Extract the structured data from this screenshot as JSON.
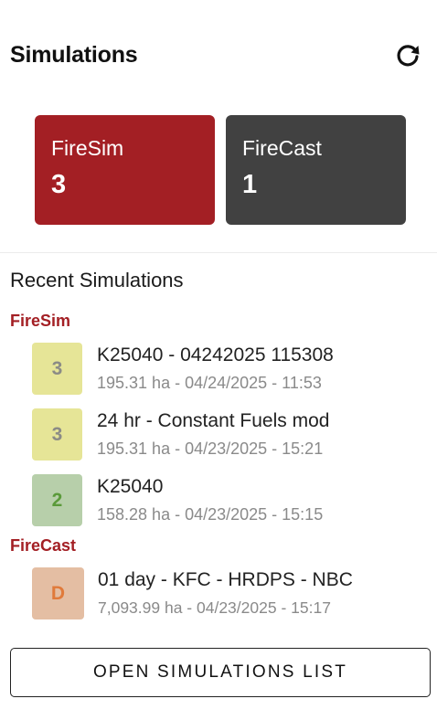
{
  "header": {
    "title": "Simulations",
    "refresh_icon": "refresh-icon"
  },
  "summary_cards": [
    {
      "label": "FireSim",
      "count": "3",
      "color": "#a31f24"
    },
    {
      "label": "FireCast",
      "count": "1",
      "color": "#414141"
    }
  ],
  "recent": {
    "title": "Recent Simulations",
    "groups": [
      {
        "label": "FireSim",
        "color": "#a31f24",
        "items": [
          {
            "badge": "3",
            "badge_bg": "#e6e597",
            "badge_fg": "#8b8b86",
            "title": "K25040 - 04242025 115308",
            "subtitle": "195.31 ha - 04/24/2025 - 11:53"
          },
          {
            "badge": "3",
            "badge_bg": "#e6e597",
            "badge_fg": "#8b8b86",
            "title": "24 hr - Constant Fuels mod",
            "subtitle": "195.31 ha - 04/23/2025 - 15:21"
          },
          {
            "badge": "2",
            "badge_bg": "#b7cfaa",
            "badge_fg": "#5a9a3a",
            "title": "K25040",
            "subtitle": "158.28 ha - 04/23/2025 - 15:15"
          }
        ]
      },
      {
        "label": "FireCast",
        "color": "#a31f24",
        "items": [
          {
            "badge": "D",
            "badge_bg": "#e4bea3",
            "badge_fg": "#e07a3a",
            "title": "01 day - KFC - HRDPS - NBC",
            "subtitle": "7,093.99 ha - 04/23/2025 - 15:17"
          }
        ]
      }
    ]
  },
  "footer": {
    "open_button_label": "OPEN SIMULATIONS LIST"
  }
}
